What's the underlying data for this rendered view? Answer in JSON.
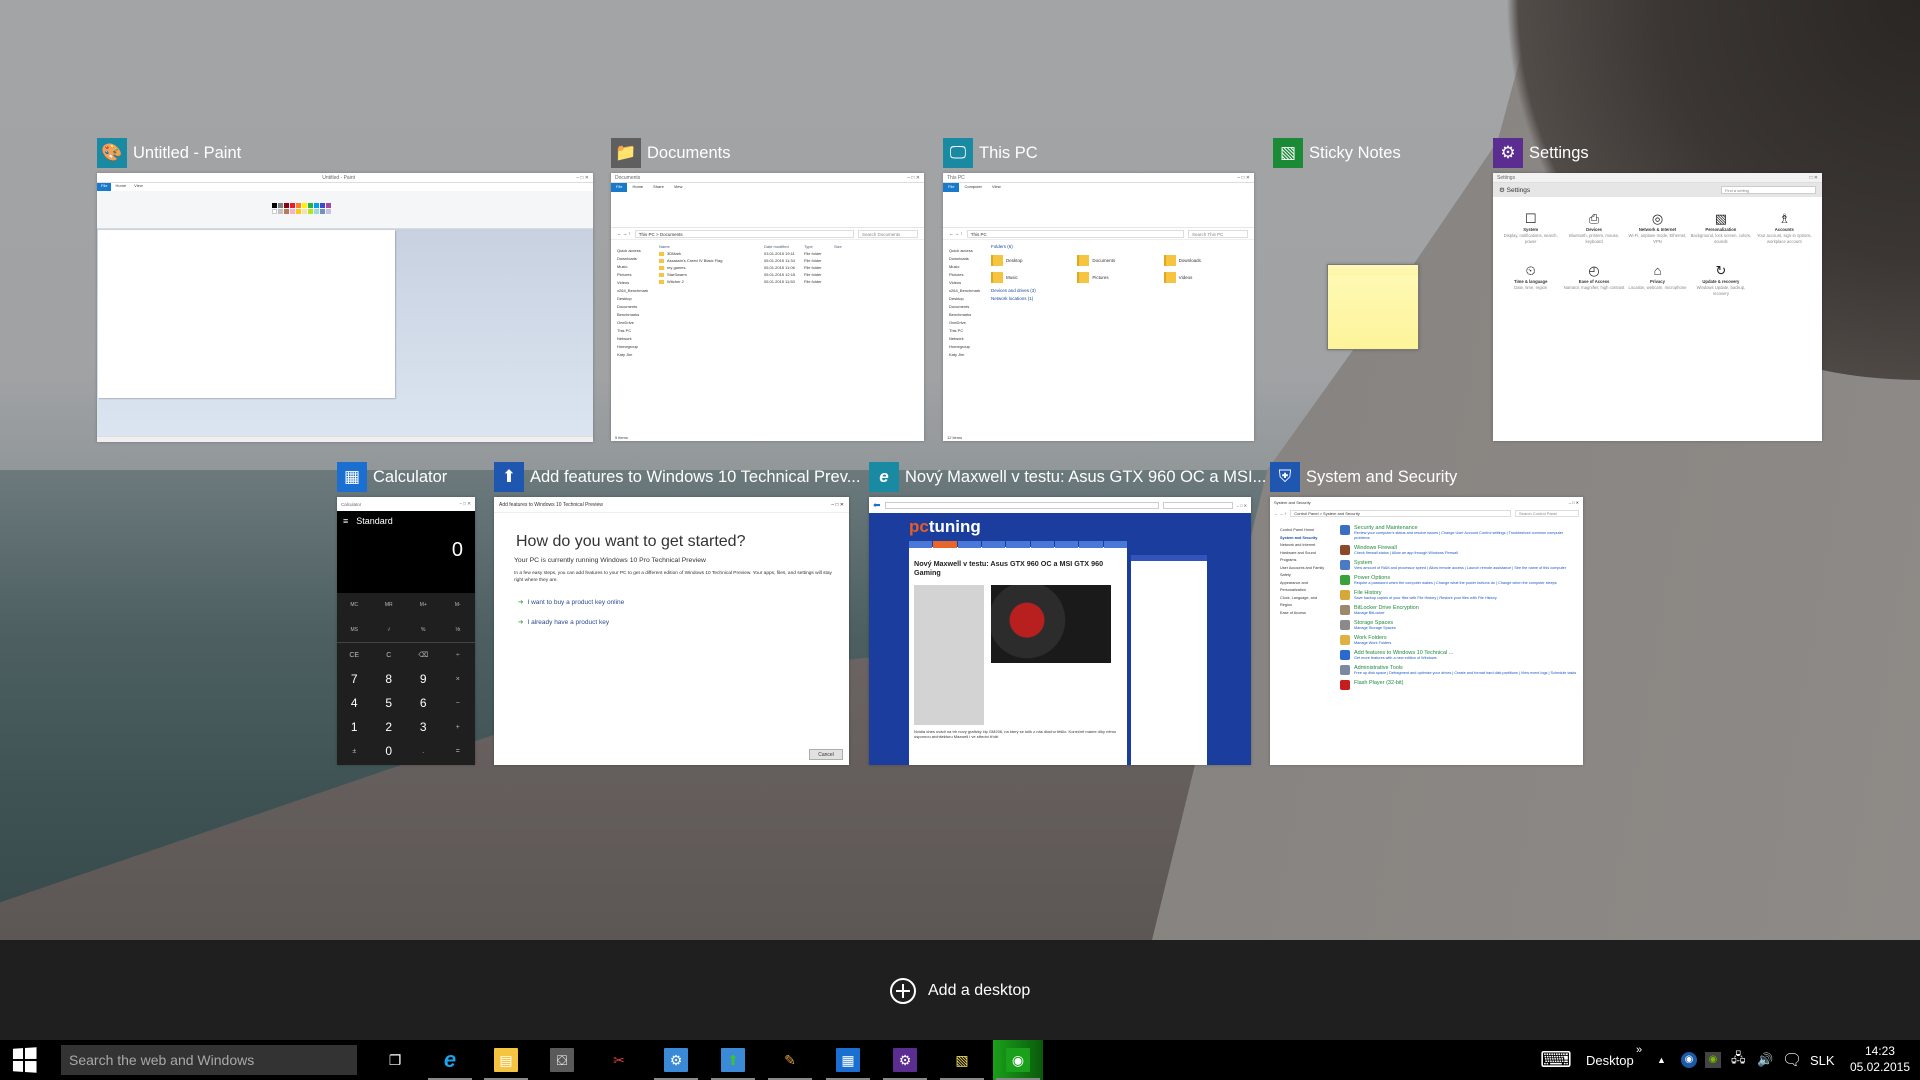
{
  "windows": [
    {
      "id": "paint",
      "title": "Untitled - Paint",
      "icon": "paint-icon",
      "icon_color": "#1a8aa3",
      "inner_title": "Untitled - Paint",
      "tabs": [
        "File",
        "Home",
        "View"
      ]
    },
    {
      "id": "documents",
      "title": "Documents",
      "icon": "documents-folder-icon",
      "icon_color": "#5f5f5f",
      "inner_title": "Documents",
      "tabs": [
        "File",
        "Home",
        "Share",
        "View"
      ],
      "path": "This PC > Documents",
      "search_placeholder": "Search Documents",
      "columns": [
        "Name",
        "Date modified",
        "Type",
        "Size"
      ],
      "rows": [
        {
          "name": "3DMark",
          "date": "03.01.2015 19:11",
          "type": "File folder"
        },
        {
          "name": "Assassin's Creed IV Black Flag",
          "date": "05.01.2015 11:34",
          "type": "File folder"
        },
        {
          "name": "my games",
          "date": "05.01.2015 11:06",
          "type": "File folder"
        },
        {
          "name": "StarSwarm",
          "date": "05.01.2015 12:15",
          "type": "File folder"
        },
        {
          "name": "Witcher 2",
          "date": "05.01.2015 11:50",
          "type": "File folder"
        }
      ],
      "nav": [
        "Quick access",
        "Downloads",
        "Music",
        "Pictures",
        "Videos",
        "x264_Benchmark",
        "Desktop",
        "Documents",
        "Benchmarks",
        "OneDrive",
        "This PC",
        "Network",
        "Homegroup",
        "Katy Jim"
      ],
      "status": "5 items"
    },
    {
      "id": "thispc",
      "title": "This PC",
      "icon": "computer-icon",
      "icon_color": "#1a8aa3",
      "inner_title": "This PC",
      "tabs": [
        "File",
        "Computer",
        "View"
      ],
      "path": "This PC",
      "search_placeholder": "Search This PC",
      "folders_header": "Folders (6)",
      "folders": [
        "Desktop",
        "Documents",
        "Downloads",
        "Music",
        "Pictures",
        "Videos"
      ],
      "sections": [
        "Devices and drives (3)",
        "Network locations (1)"
      ],
      "nav": [
        "Quick access",
        "Downloads",
        "Music",
        "Pictures",
        "Videos",
        "x264_Benchmark",
        "Desktop",
        "Documents",
        "Benchmarks",
        "OneDrive",
        "This PC",
        "Network",
        "Homegroup",
        "Katy Jim"
      ],
      "status": "12 items"
    },
    {
      "id": "sticky",
      "title": "Sticky Notes",
      "icon": "sticky-notes-icon",
      "icon_color": "#1a8a36"
    },
    {
      "id": "settings",
      "title": "Settings",
      "icon": "gear-icon",
      "icon_color": "#5c2d91",
      "inner_title": "Settings",
      "search_placeholder": "Find a setting",
      "items": [
        {
          "name": "System",
          "desc": "Display, notifications, search, power",
          "glyph": "☐"
        },
        {
          "name": "Devices",
          "desc": "Bluetooth, printers, mouse, keyboard",
          "glyph": "⎙"
        },
        {
          "name": "Network & Internet",
          "desc": "Wi-Fi, airplane mode, Ethernet, VPN",
          "glyph": "◎"
        },
        {
          "name": "Personalization",
          "desc": "Background, lock screen, colors, sounds",
          "glyph": "▧"
        },
        {
          "name": "Accounts",
          "desc": "Your account, sign-in options, workplace account",
          "glyph": "♗"
        },
        {
          "name": "Time & language",
          "desc": "Date, time, region",
          "glyph": "⏲"
        },
        {
          "name": "Ease of Access",
          "desc": "Narrator, magnifier, high contrast",
          "glyph": "◴"
        },
        {
          "name": "Privacy",
          "desc": "Location, webcam, microphone",
          "glyph": "⌂"
        },
        {
          "name": "Update & recovery",
          "desc": "Windows Update, backup, recovery",
          "glyph": "↻"
        }
      ]
    },
    {
      "id": "calculator",
      "title": "Calculator",
      "icon": "calculator-icon",
      "icon_color": "#1a6fd1",
      "inner_title": "Calculator",
      "mode": "Standard",
      "display": "0",
      "memory_keys": [
        "MC",
        "MR",
        "M+",
        "M-",
        "MS",
        "√",
        "%",
        "⅟x"
      ],
      "keys": [
        "CE",
        "C",
        "⌫",
        "÷",
        "7",
        "8",
        "9",
        "×",
        "4",
        "5",
        "6",
        "−",
        "1",
        "2",
        "3",
        "+",
        "±",
        "0",
        ".",
        "="
      ]
    },
    {
      "id": "addfeatures",
      "title": "Add features to Windows 10 Technical Prev...",
      "icon": "add-features-icon",
      "icon_color": "#1e56b0",
      "inner_title": "Add features to Windows 10 Technical Preview",
      "heading": "How do you want to get started?",
      "subheading": "Your PC is currently running Windows 10 Pro Technical Preview",
      "description": "In a few easy steps, you can add features to your PC to get a different edition of Windows 10 Technical Preview. Your apps, files, and settings will stay right where they are.",
      "links": [
        "I want to buy a product key online",
        "I already have a product key"
      ],
      "cancel": "Cancel"
    },
    {
      "id": "ie",
      "title": "Nový Maxwell v testu: Asus GTX 960 OC a MSI...",
      "icon": "internet-explorer-icon",
      "icon_color": "#1a8aa3",
      "site_logo": "pc",
      "site_logo_b": "tuning",
      "article_title": "Nový Maxwell v testu: Asus GTX 960 OC a MSI GTX 960 Gaming",
      "intro": "Nvidia dnes uvádí na trh nový grafický čip GM206, na který se tolik z nás dlouho těšilo. Konečně máme díky němu úspornou architekturu Maxwell i ve střední třídě."
    },
    {
      "id": "cpanel",
      "title": "System and Security",
      "icon": "shield-icon",
      "icon_color": "#1e56b0",
      "inner_title": "System and Security",
      "path": "Control Panel > System and Security",
      "search_placeholder": "Search Control Panel",
      "left": [
        "Control Panel Home",
        "System and Security",
        "Network and Internet",
        "Hardware and Sound",
        "Programs",
        "User Accounts and Family Safety",
        "Appearance and Personalization",
        "Clock, Language, and Region",
        "Ease of Access"
      ],
      "categories": [
        {
          "title": "Security and Maintenance",
          "links": "Review your computer's status and resolve issues | Change User Account Control settings | Troubleshoot common computer problems",
          "color": "#3a6fc4"
        },
        {
          "title": "Windows Firewall",
          "links": "Check firewall status | Allow an app through Windows Firewall",
          "color": "#8a4a2a"
        },
        {
          "title": "System",
          "links": "View amount of RAM and processor speed | Allow remote access | Launch remote assistance | See the name of this computer",
          "color": "#4a7ac4"
        },
        {
          "title": "Power Options",
          "links": "Require a password when the computer wakes | Change what the power buttons do | Change when the computer sleeps",
          "color": "#3aa23a"
        },
        {
          "title": "File History",
          "links": "Save backup copies of your files with File History | Restore your files with File History",
          "color": "#d6a83a"
        },
        {
          "title": "BitLocker Drive Encryption",
          "links": "Manage BitLocker",
          "color": "#9a8a6a"
        },
        {
          "title": "Storage Spaces",
          "links": "Manage Storage Spaces",
          "color": "#8a8a8a"
        },
        {
          "title": "Work Folders",
          "links": "Manage Work Folders",
          "color": "#e0b040"
        },
        {
          "title": "Add features to Windows 10 Technical ...",
          "links": "Get more features with a new edition of Windows",
          "color": "#2a6ad0"
        },
        {
          "title": "Administrative Tools",
          "links": "Free up disk space | Defragment and optimize your drives | Create and format hard disk partitions | View event logs | Schedule tasks",
          "color": "#7a8aa0"
        },
        {
          "title": "Flash Player (32-bit)",
          "links": "",
          "color": "#c41e1e"
        }
      ]
    }
  ],
  "add_desktop": {
    "label": "Add a desktop"
  },
  "taskbar": {
    "search_placeholder": "Search the web and Windows",
    "apps": [
      {
        "name": "task-view",
        "glyph": "❐",
        "bg": "transparent",
        "running": false
      },
      {
        "name": "internet-explorer",
        "glyph": "e",
        "bg": "transparent",
        "color": "#1ea1e8",
        "running": true
      },
      {
        "name": "file-explorer",
        "glyph": "▤",
        "bg": "#f5c542",
        "running": true
      },
      {
        "name": "store",
        "glyph": "⛋",
        "bg": "#5a5a5a",
        "running": false
      },
      {
        "name": "snipping-tool",
        "glyph": "✂",
        "bg": "transparent",
        "color": "#e04040",
        "running": false
      },
      {
        "name": "control-panel",
        "glyph": "⚙",
        "bg": "#3a8ad8",
        "running": true
      },
      {
        "name": "add-features",
        "glyph": "⬆",
        "bg": "#3a8ad8",
        "color": "#3ac23a",
        "running": true
      },
      {
        "name": "paint",
        "glyph": "✎",
        "bg": "transparent",
        "color": "#e0a040",
        "running": true
      },
      {
        "name": "calculator",
        "glyph": "▦",
        "bg": "#1a6fd1",
        "running": true
      },
      {
        "name": "settings",
        "glyph": "⚙",
        "bg": "#5c2d91",
        "running": true
      },
      {
        "name": "sticky-notes",
        "glyph": "▧",
        "bg": "transparent",
        "color": "#f5e060",
        "running": true
      },
      {
        "name": "steam",
        "glyph": "◉",
        "bg": "#1aa01a",
        "running": true
      }
    ],
    "tray": {
      "toolbar_label": "Desktop",
      "expand": "»",
      "language": "SLK",
      "time": "14:23",
      "date": "05.02.2015"
    }
  }
}
